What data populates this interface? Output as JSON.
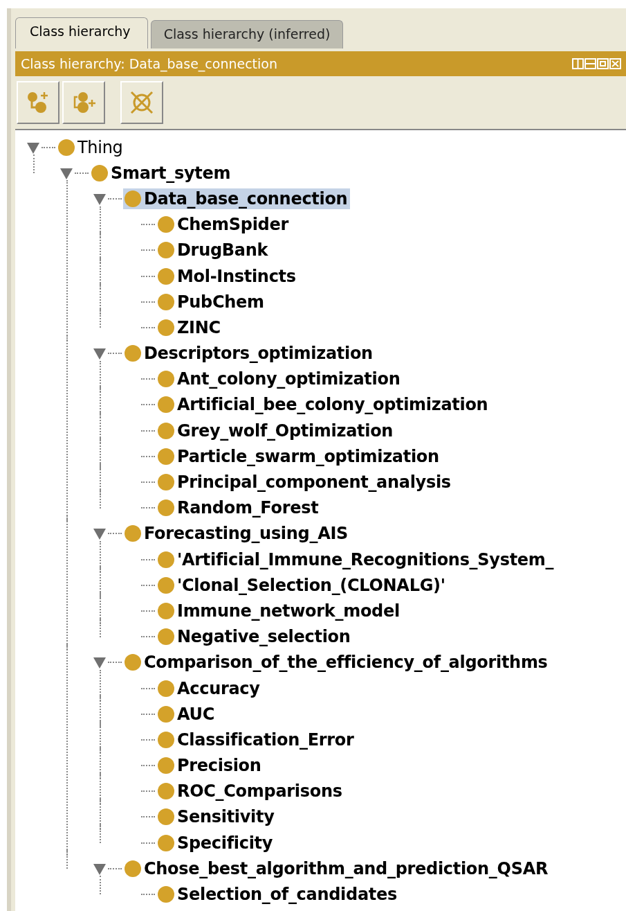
{
  "tabs": [
    {
      "label": "Class hierarchy",
      "selected": true
    },
    {
      "label": "Class hierarchy (inferred)",
      "selected": false
    }
  ],
  "panel": {
    "title": "Class hierarchy: Data_base_connection"
  },
  "tree": [
    {
      "label": "Thing",
      "kind": "root",
      "selected": false,
      "expanded": true,
      "children": [
        {
          "label": "Smart_sytem",
          "kind": "class",
          "selected": false,
          "expanded": true,
          "children": [
            {
              "label": "Data_base_connection",
              "kind": "class",
              "selected": true,
              "expanded": true,
              "children": [
                {
                  "label": "ChemSpider",
                  "kind": "class",
                  "selected": false
                },
                {
                  "label": "DrugBank",
                  "kind": "class",
                  "selected": false
                },
                {
                  "label": "Mol-Instincts",
                  "kind": "class",
                  "selected": false
                },
                {
                  "label": "PubChem",
                  "kind": "class",
                  "selected": false
                },
                {
                  "label": "ZINC",
                  "kind": "class",
                  "selected": false
                }
              ]
            },
            {
              "label": "Descriptors_optimization",
              "kind": "class",
              "selected": false,
              "expanded": true,
              "children": [
                {
                  "label": "Ant_colony_optimization",
                  "kind": "class",
                  "selected": false
                },
                {
                  "label": "Artificial_bee_colony_optimization",
                  "kind": "class",
                  "selected": false
                },
                {
                  "label": "Grey_wolf_Optimization",
                  "kind": "class",
                  "selected": false
                },
                {
                  "label": "Particle_swarm_optimization",
                  "kind": "class",
                  "selected": false
                },
                {
                  "label": "Principal_component_analysis",
                  "kind": "class",
                  "selected": false
                },
                {
                  "label": "Random_Forest",
                  "kind": "class",
                  "selected": false
                }
              ]
            },
            {
              "label": "Forecasting_using_AIS",
              "kind": "class",
              "selected": false,
              "expanded": true,
              "children": [
                {
                  "label": "'Artificial_Immune_Recognitions_System_",
                  "kind": "class",
                  "selected": false
                },
                {
                  "label": "'Clonal_Selection_(CLONALG)'",
                  "kind": "class",
                  "selected": false
                },
                {
                  "label": "Immune_network_model",
                  "kind": "class",
                  "selected": false
                },
                {
                  "label": "Negative_selection",
                  "kind": "class",
                  "selected": false
                }
              ]
            },
            {
              "label": "Comparison_of_the_efficiency_of_algorithms",
              "kind": "class",
              "selected": false,
              "expanded": true,
              "children": [
                {
                  "label": "Accuracy",
                  "kind": "class",
                  "selected": false
                },
                {
                  "label": "AUC",
                  "kind": "class",
                  "selected": false
                },
                {
                  "label": "Classification_Error",
                  "kind": "class",
                  "selected": false
                },
                {
                  "label": "Precision",
                  "kind": "class",
                  "selected": false
                },
                {
                  "label": "ROC_Comparisons",
                  "kind": "class",
                  "selected": false
                },
                {
                  "label": "Sensitivity",
                  "kind": "class",
                  "selected": false
                },
                {
                  "label": "Specificity",
                  "kind": "class",
                  "selected": false
                }
              ]
            },
            {
              "label": "Chose_best_algorithm_and_prediction_QSAR",
              "kind": "class",
              "selected": false,
              "expanded": true,
              "children": [
                {
                  "label": "Selection_of_candidates",
                  "kind": "class",
                  "selected": false
                }
              ]
            }
          ]
        }
      ]
    }
  ]
}
